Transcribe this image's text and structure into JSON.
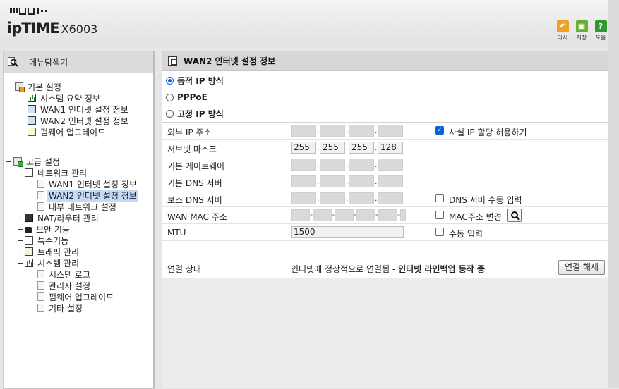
{
  "header": {
    "brand": "ipTIME",
    "model": "X6003",
    "buttons": [
      {
        "label": "다시",
        "icon": "undo-icon",
        "color": "#f0a020"
      },
      {
        "label": "저장",
        "icon": "save-icon",
        "color": "#66b030"
      },
      {
        "label": "도움",
        "icon": "help-icon",
        "color": "#2e9a2e",
        "glyph": "?"
      }
    ]
  },
  "sidebar": {
    "title": "메뉴탐색기",
    "basic": {
      "label": "기본 설정",
      "items": [
        "시스템 요약 정보",
        "WAN1 인터넷 설정 정보",
        "WAN2 인터넷 설정 정보",
        "펌웨어 업그레이드"
      ]
    },
    "advanced": {
      "label": "고급 설정",
      "network": {
        "label": "네트워크 관리",
        "items": [
          "WAN1 인터넷 설정 정보",
          "WAN2 인터넷 설정 정보",
          "내부 네트워크 설정"
        ],
        "selected": "WAN2 인터넷 설정 정보"
      },
      "groups": [
        "NAT/라우터 관리",
        "보안 기능",
        "특수기능",
        "트래픽 관리"
      ],
      "system": {
        "label": "시스템 관리",
        "items": [
          "시스템 로그",
          "관리자 설정",
          "펌웨어 업그레이드",
          "기타 설정"
        ]
      }
    }
  },
  "main": {
    "title": "WAN2 인터넷 설정 정보",
    "modes": [
      {
        "label": "동적 IP 방식",
        "selected": true
      },
      {
        "label": "PPPoE",
        "selected": false
      },
      {
        "label": "고정 IP 방식",
        "selected": false
      }
    ],
    "fields": {
      "external_ip": {
        "label": "외부 IP 주소",
        "octets": [
          "",
          "",
          "",
          ""
        ]
      },
      "subnet_mask": {
        "label": "서브넷 마스크",
        "octets": [
          "255",
          "255",
          "255",
          "128"
        ]
      },
      "gateway": {
        "label": "기본 게이트웨이",
        "octets": [
          "",
          "",
          "",
          ""
        ]
      },
      "dns_primary": {
        "label": "기본 DNS 서버",
        "octets": [
          "",
          "",
          "",
          ""
        ]
      },
      "dns_secondary": {
        "label": "보조 DNS 서버",
        "octets": [
          "",
          "",
          "",
          ""
        ]
      },
      "wan_mac": {
        "label": "WAN MAC 주소"
      },
      "mtu": {
        "label": "MTU",
        "value": "1500"
      }
    },
    "options": {
      "private_ip": {
        "label": "사설 IP 할당 허용하기",
        "checked": true
      },
      "dns_manual": {
        "label": "DNS 서버 수동 입력",
        "checked": false
      },
      "mac_change": {
        "label": "MAC주소 변경",
        "checked": false
      },
      "mtu_manual": {
        "label": "수동 입력",
        "checked": false
      }
    },
    "connection": {
      "label": "연결 상태",
      "status_plain": "인터넷에 정상적으로 연결됨 - ",
      "status_bold": "인터넷 라인백업 동작 중",
      "disconnect_label": "연결 해제"
    }
  }
}
